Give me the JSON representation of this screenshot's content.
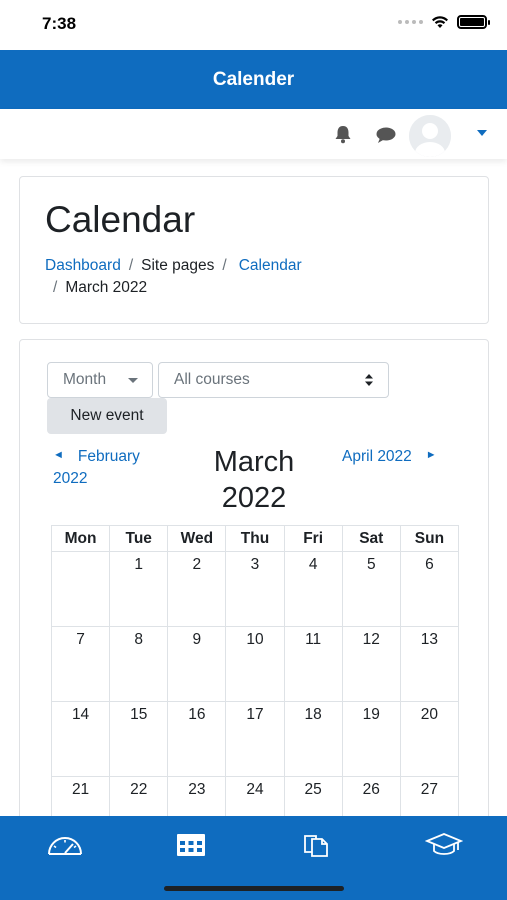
{
  "status_bar": {
    "time": "7:38"
  },
  "header": {
    "title": "Calender"
  },
  "page": {
    "title": "Calendar",
    "breadcrumb": {
      "dashboard": "Dashboard",
      "site_pages": "Site pages",
      "calendar": "Calendar",
      "current": "March 2022",
      "separator": "/"
    }
  },
  "calendar": {
    "view_select": "Month",
    "course_select": "All courses",
    "new_event": "New event",
    "prev_month": {
      "line1": "February",
      "line2": "2022",
      "arrow": "◄"
    },
    "next_month": {
      "label": "April 2022",
      "arrow": "►"
    },
    "current_month": {
      "line1": "March",
      "line2": "2022"
    },
    "weekdays": [
      "Mon",
      "Tue",
      "Wed",
      "Thu",
      "Fri",
      "Sat",
      "Sun"
    ],
    "weeks": [
      [
        "",
        "1",
        "2",
        "3",
        "4",
        "5",
        "6"
      ],
      [
        "7",
        "8",
        "9",
        "10",
        "11",
        "12",
        "13"
      ],
      [
        "14",
        "15",
        "16",
        "17",
        "18",
        "19",
        "20"
      ],
      [
        "21",
        "22",
        "23",
        "24",
        "25",
        "26",
        "27"
      ]
    ]
  },
  "bottom_nav": {
    "tabs": [
      {
        "icon": "dashboard-gauge-icon"
      },
      {
        "icon": "calendar-grid-icon",
        "active": true
      },
      {
        "icon": "files-icon"
      },
      {
        "icon": "graduation-cap-icon"
      }
    ]
  },
  "colors": {
    "brand": "#0f6cbf",
    "text": "#1d2125",
    "muted": "#6a737b",
    "border": "#dee2e6"
  }
}
